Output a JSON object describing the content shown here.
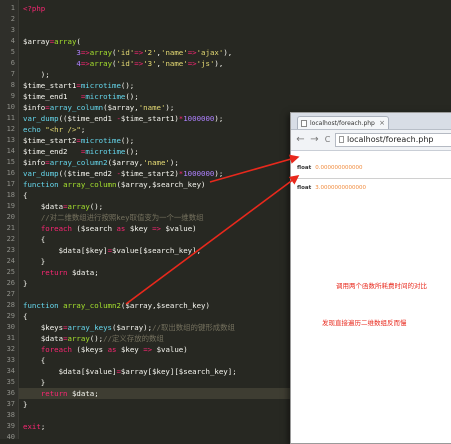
{
  "editor": {
    "line_numbers": [
      "1",
      "2",
      "3",
      "4",
      "5",
      "6",
      "7",
      "8",
      "9",
      "10",
      "11",
      "12",
      "13",
      "14",
      "15",
      "16",
      "17",
      "18",
      "19",
      "20",
      "21",
      "22",
      "23",
      "24",
      "25",
      "26",
      "27",
      "28",
      "29",
      "30",
      "31",
      "32",
      "33",
      "34",
      "35",
      "36",
      "37",
      "38",
      "39",
      "40"
    ]
  },
  "browser": {
    "tab_title": "localhost/foreach.php",
    "tab_close": "×",
    "url": "localhost/foreach.php",
    "back": "←",
    "forward": "→",
    "reload": "C",
    "output": [
      {
        "label": "float",
        "value": "0.000000000000"
      },
      {
        "label": "float",
        "value": "3.0000000000000"
      }
    ],
    "note_compare": "调用两个函数所耗费时间的对比",
    "note_slow": "发现直接遍历二维数组反而慢"
  },
  "colors": {
    "background": "#272822",
    "keyword": "#66d9ef",
    "string": "#e6db74",
    "number": "#ae81ff",
    "operator": "#f92672",
    "comment": "#75715e",
    "annotation": "#e8281c",
    "arrow": "#e8281c"
  }
}
